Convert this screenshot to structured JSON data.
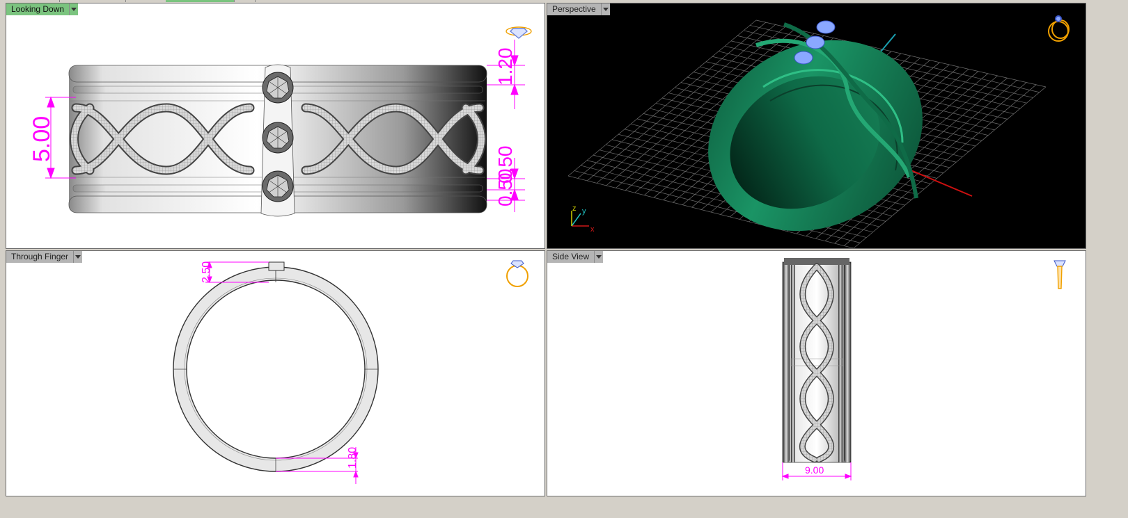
{
  "viewports": {
    "top_left": {
      "label": "Looking Down"
    },
    "top_right": {
      "label": "Perspective"
    },
    "bottom_left": {
      "label": "Through Finger"
    },
    "bottom_right": {
      "label": "Side View"
    }
  },
  "dimensions": {
    "looking_down": {
      "width": "5.00",
      "top": "1.20",
      "bottom_a": "0.50",
      "bottom_b": "0.50"
    },
    "through_finger": {
      "top": "2.50",
      "bottom": "1.80"
    },
    "side_view": {
      "width": "9.00"
    }
  },
  "axes": {
    "x": "x",
    "y": "y",
    "z": "z"
  },
  "colors": {
    "active_tab": "#7bc47f",
    "dimension": "#ff00ff",
    "ring_green": "#147a52",
    "gem_blue": "#8aa8ff",
    "view_icon": "#f0a000"
  },
  "icons": [
    "ring-top-icon",
    "ring-perspective-icon",
    "ring-front-icon",
    "ring-side-icon"
  ]
}
